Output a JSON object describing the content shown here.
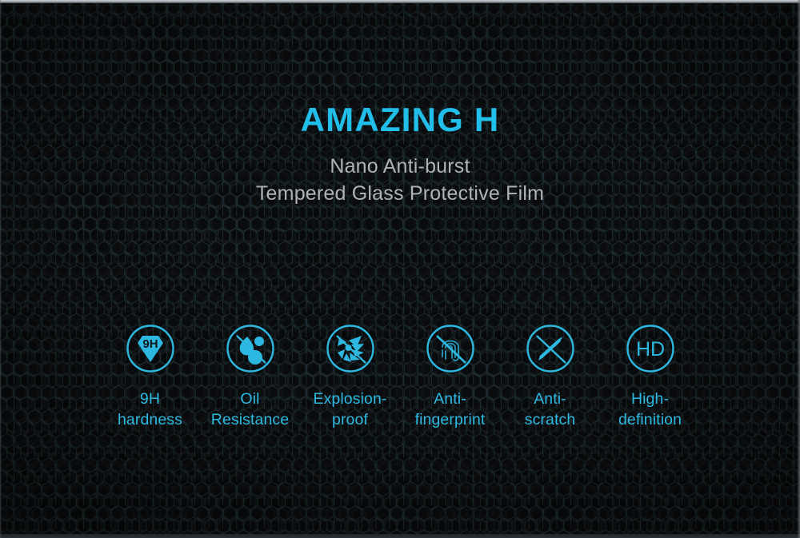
{
  "banner": {
    "title": "AMAZING H",
    "subtitle_lines": [
      "Nano Anti-burst",
      "Tempered Glass Protective Film"
    ],
    "colors": {
      "accent": "#22beea",
      "label": "#2cb8e0",
      "subtitle": "#aeb3b7",
      "background": "#15181a"
    }
  },
  "features": [
    {
      "icon": "9h-diamond-icon",
      "label_lines": [
        "9H",
        "hardness"
      ],
      "icon_text": "9H"
    },
    {
      "icon": "oil-drop-no-icon",
      "label_lines": [
        "Oil",
        "Resistance"
      ],
      "icon_text": ""
    },
    {
      "icon": "explosion-burst-no-icon",
      "label_lines": [
        "Explosion-",
        "proof"
      ],
      "icon_text": ""
    },
    {
      "icon": "fingerprint-no-icon",
      "label_lines": [
        "Anti-",
        "fingerprint"
      ],
      "icon_text": ""
    },
    {
      "icon": "knife-scratch-no-icon",
      "label_lines": [
        "Anti-",
        "scratch"
      ],
      "icon_text": ""
    },
    {
      "icon": "hd-circle-icon",
      "label_lines": [
        "High-",
        "definition"
      ],
      "icon_text": "HD"
    }
  ]
}
